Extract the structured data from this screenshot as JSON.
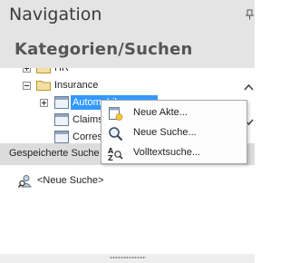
{
  "header": {
    "title": "Navigation",
    "section": "Kategorien/Suchen"
  },
  "tree": {
    "items": [
      {
        "label": "HR",
        "icon": "folder-icon",
        "expander": "plus"
      },
      {
        "label": "Insurance",
        "icon": "folder-icon",
        "expander": "minus"
      },
      {
        "label": "Automobil",
        "icon": "document-icon",
        "expander": "plus",
        "selected": true
      },
      {
        "label": "Claims",
        "icon": "document-icon"
      },
      {
        "label": "Corres",
        "icon": "document-icon"
      }
    ]
  },
  "context_menu": {
    "items": [
      {
        "label": "Neue Akte...",
        "icon": "new-file-icon"
      },
      {
        "label": "Neue Suche...",
        "icon": "magnifier-icon"
      },
      {
        "label": "Volltextsuche...",
        "icon": "fulltext-search-icon"
      }
    ]
  },
  "saved_searches": {
    "label": "Gespeicherte Suche",
    "items": [
      {
        "label": "<Neue Suche>",
        "icon": "search-person-icon"
      }
    ]
  },
  "colors": {
    "selection": "#3399ff",
    "panel_bg": "#e4e4e4",
    "saved_bar_bg": "#dcdcdc"
  }
}
